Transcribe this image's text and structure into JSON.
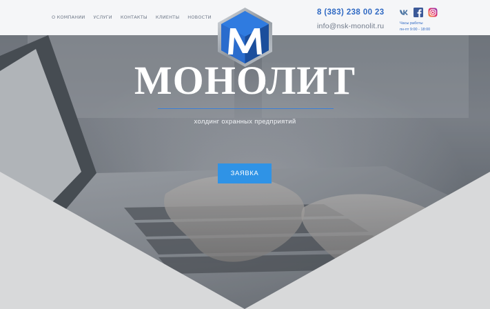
{
  "nav": {
    "items": [
      {
        "label": "О КОМПАНИИ"
      },
      {
        "label": "УСЛУГИ"
      },
      {
        "label": "КОНТАКТЫ"
      },
      {
        "label": "КЛИЕНТЫ"
      },
      {
        "label": "НОВОСТИ"
      }
    ]
  },
  "contacts": {
    "phone": "8 (383) 238 00 23",
    "email": "info@nsk-monolit.ru",
    "hours_label": "Часы работы",
    "hours": "пн-пт 9:00 - 18:00"
  },
  "socials": [
    {
      "icon": "vk-icon",
      "color": "#4c75a3"
    },
    {
      "icon": "facebook-icon",
      "color": "#3b5998"
    },
    {
      "icon": "instagram-icon",
      "color": "#e1306c"
    }
  ],
  "logo": {
    "icon": "monolit-cube-logo"
  },
  "hero": {
    "title": "МОНОЛИТ",
    "subtitle": "холдинг охранных предприятий",
    "cta_label": "ЗАЯВКА"
  },
  "colors": {
    "accent": "#2f93e6",
    "link_blue": "#2f69c3",
    "nav_gray": "#6d7787",
    "header_bg": "#f5f6f8"
  }
}
